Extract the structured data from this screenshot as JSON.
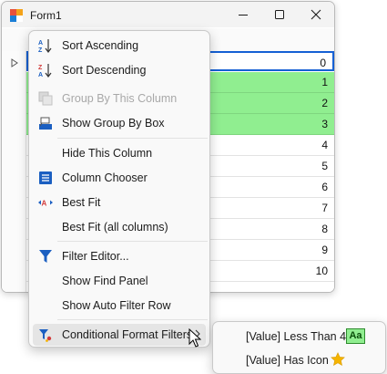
{
  "window": {
    "title": "Form1"
  },
  "grid": {
    "rows": [
      {
        "value": "0",
        "state": "focused"
      },
      {
        "value": "1",
        "state": "highlighted"
      },
      {
        "value": "2",
        "state": "highlighted"
      },
      {
        "value": "3",
        "state": "highlighted"
      },
      {
        "value": "4",
        "state": "normal"
      },
      {
        "value": "5",
        "state": "normal"
      },
      {
        "value": "6",
        "state": "normal"
      },
      {
        "value": "7",
        "state": "normal"
      },
      {
        "value": "8",
        "state": "normal"
      },
      {
        "value": "9",
        "state": "normal"
      },
      {
        "value": "10",
        "state": "normal"
      }
    ],
    "highlight_color": "#90ee90",
    "focus_color": "#1560d4"
  },
  "menu": {
    "items": [
      {
        "label": "Sort Ascending",
        "icon": "sort-ascending-icon",
        "enabled": true
      },
      {
        "label": "Sort Descending",
        "icon": "sort-descending-icon",
        "enabled": true
      },
      {
        "label": "Group By This Column",
        "icon": "group-by-column-icon",
        "enabled": false
      },
      {
        "label": "Show Group By Box",
        "icon": "group-by-box-icon",
        "enabled": true
      },
      {
        "label": "Hide This Column",
        "icon": "",
        "enabled": true
      },
      {
        "label": "Column Chooser",
        "icon": "column-chooser-icon",
        "enabled": true
      },
      {
        "label": "Best Fit",
        "icon": "best-fit-icon",
        "enabled": true
      },
      {
        "label": "Best Fit (all columns)",
        "icon": "",
        "enabled": true
      },
      {
        "label": "Filter Editor...",
        "icon": "filter-icon",
        "enabled": true
      },
      {
        "label": "Show Find Panel",
        "icon": "",
        "enabled": true
      },
      {
        "label": "Show Auto Filter Row",
        "icon": "",
        "enabled": true
      },
      {
        "label": "Conditional Format Filters",
        "icon": "conditional-format-filter-icon",
        "enabled": true,
        "has_submenu": true
      }
    ]
  },
  "submenu": {
    "items": [
      {
        "label": "[Value] Less Than 4",
        "badge": "Aa",
        "badge_color": "#90ee90"
      },
      {
        "label": "[Value] Has Icon",
        "icon": "star-icon",
        "icon_color": "#f5b400"
      }
    ]
  }
}
